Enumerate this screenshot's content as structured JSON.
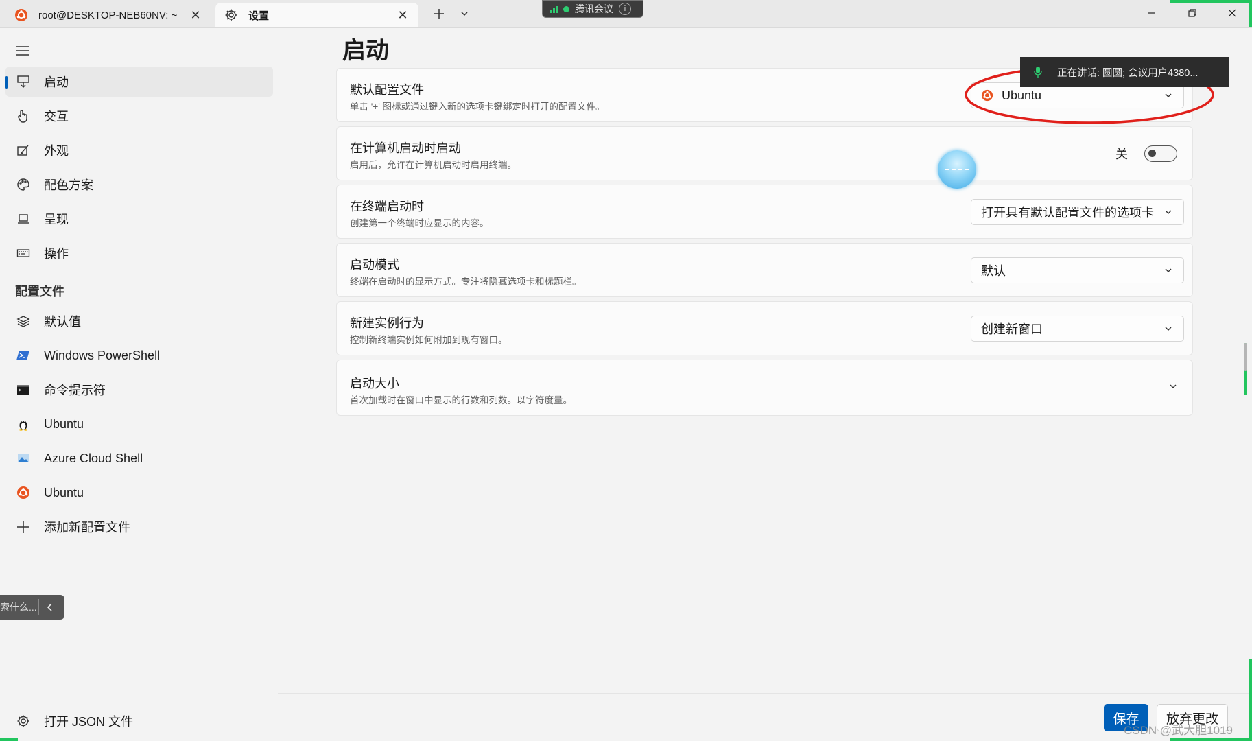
{
  "tabs": [
    {
      "label": "root@DESKTOP-NEB60NV: ~",
      "icon": "ubuntu-icon"
    },
    {
      "label": "设置",
      "icon": "gear-icon"
    }
  ],
  "meeting_badge": {
    "label": "腾讯会议",
    "info": "i"
  },
  "speaking_popup": {
    "text": "正在讲话: 圆圆; 会议用户4380..."
  },
  "sidebar": {
    "nav": [
      {
        "label": "启动",
        "icon": "startup-icon",
        "active": true
      },
      {
        "label": "交互",
        "icon": "pointer-hand-icon"
      },
      {
        "label": "外观",
        "icon": "brush-icon"
      },
      {
        "label": "配色方案",
        "icon": "palette-icon"
      },
      {
        "label": "呈现",
        "icon": "monitor-icon"
      },
      {
        "label": "操作",
        "icon": "keyboard-icon"
      }
    ],
    "profiles_header": "配置文件",
    "profiles": [
      {
        "label": "默认值",
        "icon": "layers-icon"
      },
      {
        "label": "Windows PowerShell",
        "icon": "powershell-icon"
      },
      {
        "label": "命令提示符",
        "icon": "cmd-icon"
      },
      {
        "label": "Ubuntu",
        "icon": "tux-icon"
      },
      {
        "label": "Azure Cloud Shell",
        "icon": "azure-icon"
      },
      {
        "label": "Ubuntu",
        "icon": "ubuntu-icon"
      },
      {
        "label": "添加新配置文件",
        "icon": "plus-icon"
      }
    ],
    "tooltip_text": "索什么...",
    "open_json": "打开 JSON 文件"
  },
  "page": {
    "title": "启动"
  },
  "settings": [
    {
      "title": "默认配置文件",
      "desc": "单击 '+' 图标或通过键入新的选项卡键绑定时打开的配置文件。",
      "value": "Ubuntu"
    },
    {
      "title": "在计算机启动时启动",
      "desc": "启用后，允许在计算机启动时启用终端。",
      "toggle_label": "关",
      "toggle_on": false
    },
    {
      "title": "在终端启动时",
      "desc": "创建第一个终端时应显示的内容。",
      "value": "打开具有默认配置文件的选项卡"
    },
    {
      "title": "启动模式",
      "desc": "终端在启动时的显示方式。专注将隐藏选项卡和标题栏。",
      "value": "默认"
    },
    {
      "title": "新建实例行为",
      "desc": "控制新终端实例如何附加到现有窗口。",
      "value": "创建新窗口"
    },
    {
      "title": "启动大小",
      "desc": "首次加载时在窗口中显示的行数和列数。以字符度量。"
    }
  ],
  "footer": {
    "save": "保存",
    "discard": "放弃更改"
  },
  "watermark": "CSDN @武大胆1019",
  "colors": {
    "accent": "#005fb8",
    "annotation_red": "#e0201b",
    "ubuntu_orange": "#e95420"
  }
}
